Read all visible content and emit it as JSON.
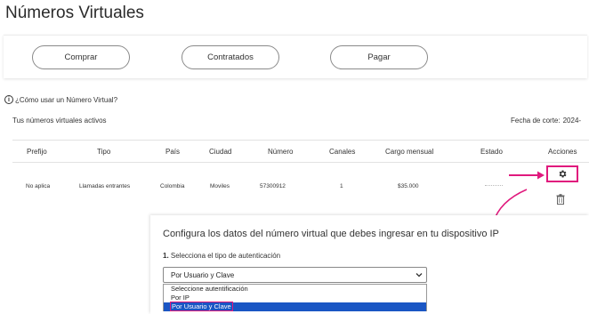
{
  "page": {
    "title": "Números Virtuales"
  },
  "actions": {
    "buy": "Comprar",
    "contracted": "Contratados",
    "pay": "Pagar"
  },
  "help_link": "¿Cómo usar un Número Virtual?",
  "section": {
    "title": "Tus números virtuales activos",
    "cutoff_label": "Fecha de corte:",
    "cutoff_value": "2024-"
  },
  "table": {
    "headers": [
      "Prefijo",
      "Tipo",
      "País",
      "Ciudad",
      "Número",
      "Canales",
      "Cargo mensual",
      "Estado",
      "Acciones"
    ],
    "rows": [
      {
        "prefijo": "No aplica",
        "tipo": "Llamadas entrantes",
        "pais": "Colombia",
        "ciudad": "Moviles",
        "numero": "57300912",
        "canales": "1",
        "cargo": "$35.000",
        "estado": ""
      }
    ]
  },
  "icons": {
    "settings": "gear-icon",
    "delete": "trash-icon",
    "info": "info-icon"
  },
  "colors": {
    "highlight": "#e0197d",
    "selected_option": "#1a56c4"
  },
  "config_panel": {
    "title": "Configura los datos del número virtual que debes ingresar en tu dispositivo IP",
    "step_number": "1.",
    "step_label": "Selecciona el tipo de autenticación",
    "select_value": "Por Usuario y Clave",
    "options": [
      "Seleccione autentificación",
      "Por IP",
      "Por Usuario y Clave"
    ],
    "selected_index": 2
  }
}
